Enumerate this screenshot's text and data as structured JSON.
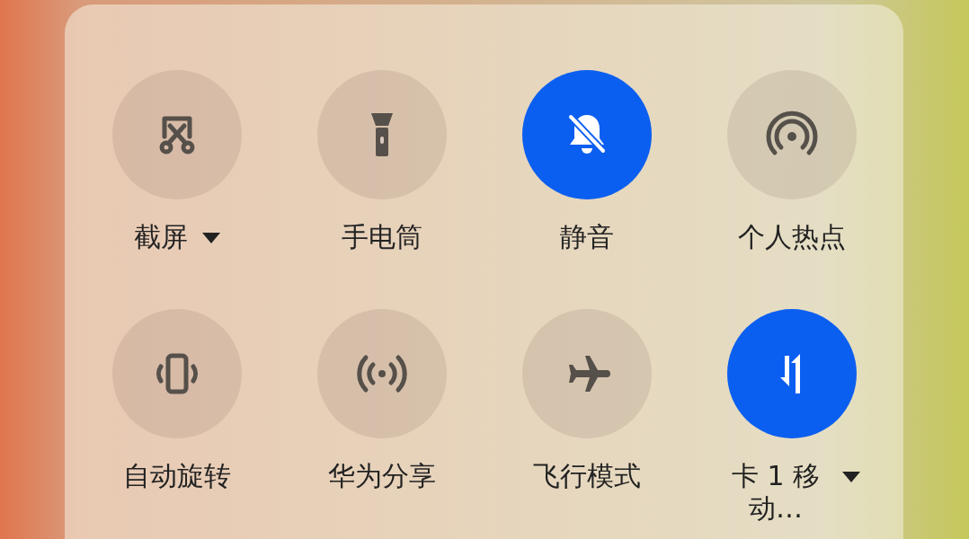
{
  "tiles": [
    {
      "label": "截屏",
      "kind": "screenshot",
      "on": false,
      "menu": true
    },
    {
      "label": "手电筒",
      "kind": "flashlight",
      "on": false,
      "menu": false
    },
    {
      "label": "静音",
      "kind": "mute",
      "on": true,
      "menu": false
    },
    {
      "label": "个人热点",
      "kind": "hotspot",
      "on": false,
      "menu": false
    },
    {
      "label": "自动旋转",
      "kind": "rotate",
      "on": false,
      "menu": false
    },
    {
      "label": "华为分享",
      "kind": "share",
      "on": false,
      "menu": false
    },
    {
      "label": "飞行模式",
      "kind": "airplane",
      "on": false,
      "menu": false
    },
    {
      "label": "卡 1 移动…",
      "kind": "data",
      "on": true,
      "menu": true
    }
  ]
}
